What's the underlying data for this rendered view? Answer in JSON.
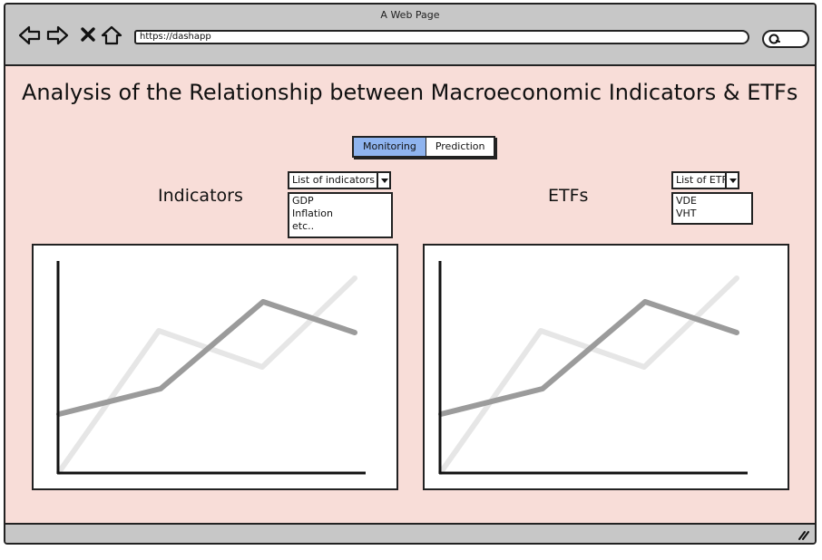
{
  "window": {
    "title": "A Web Page",
    "url": "https://dashapp"
  },
  "page": {
    "heading": "Analysis of the Relationship between Macroeconomic Indicators & ETFs"
  },
  "tabs": [
    {
      "label": "Monitoring",
      "active": true
    },
    {
      "label": "Prediction",
      "active": false
    }
  ],
  "indicators": {
    "title": "Indicators",
    "dropdown_label": "List of indicators",
    "options": [
      "GDP",
      "Inflation",
      "etc.."
    ]
  },
  "etfs": {
    "title": "ETFs",
    "dropdown_label": "List of ETFs",
    "options": [
      "VDE",
      "VHT"
    ]
  },
  "colors": {
    "accent_tab": "#8fb4ef",
    "page_bg": "#f8ddd8",
    "chrome": "#c7c7c7",
    "series_dark": "#9b9b9b",
    "series_light": "#e6e6e6"
  },
  "icons": [
    "back-arrow-icon",
    "forward-arrow-icon",
    "close-icon",
    "home-icon",
    "search-icon",
    "resize-grip-icon"
  ]
}
